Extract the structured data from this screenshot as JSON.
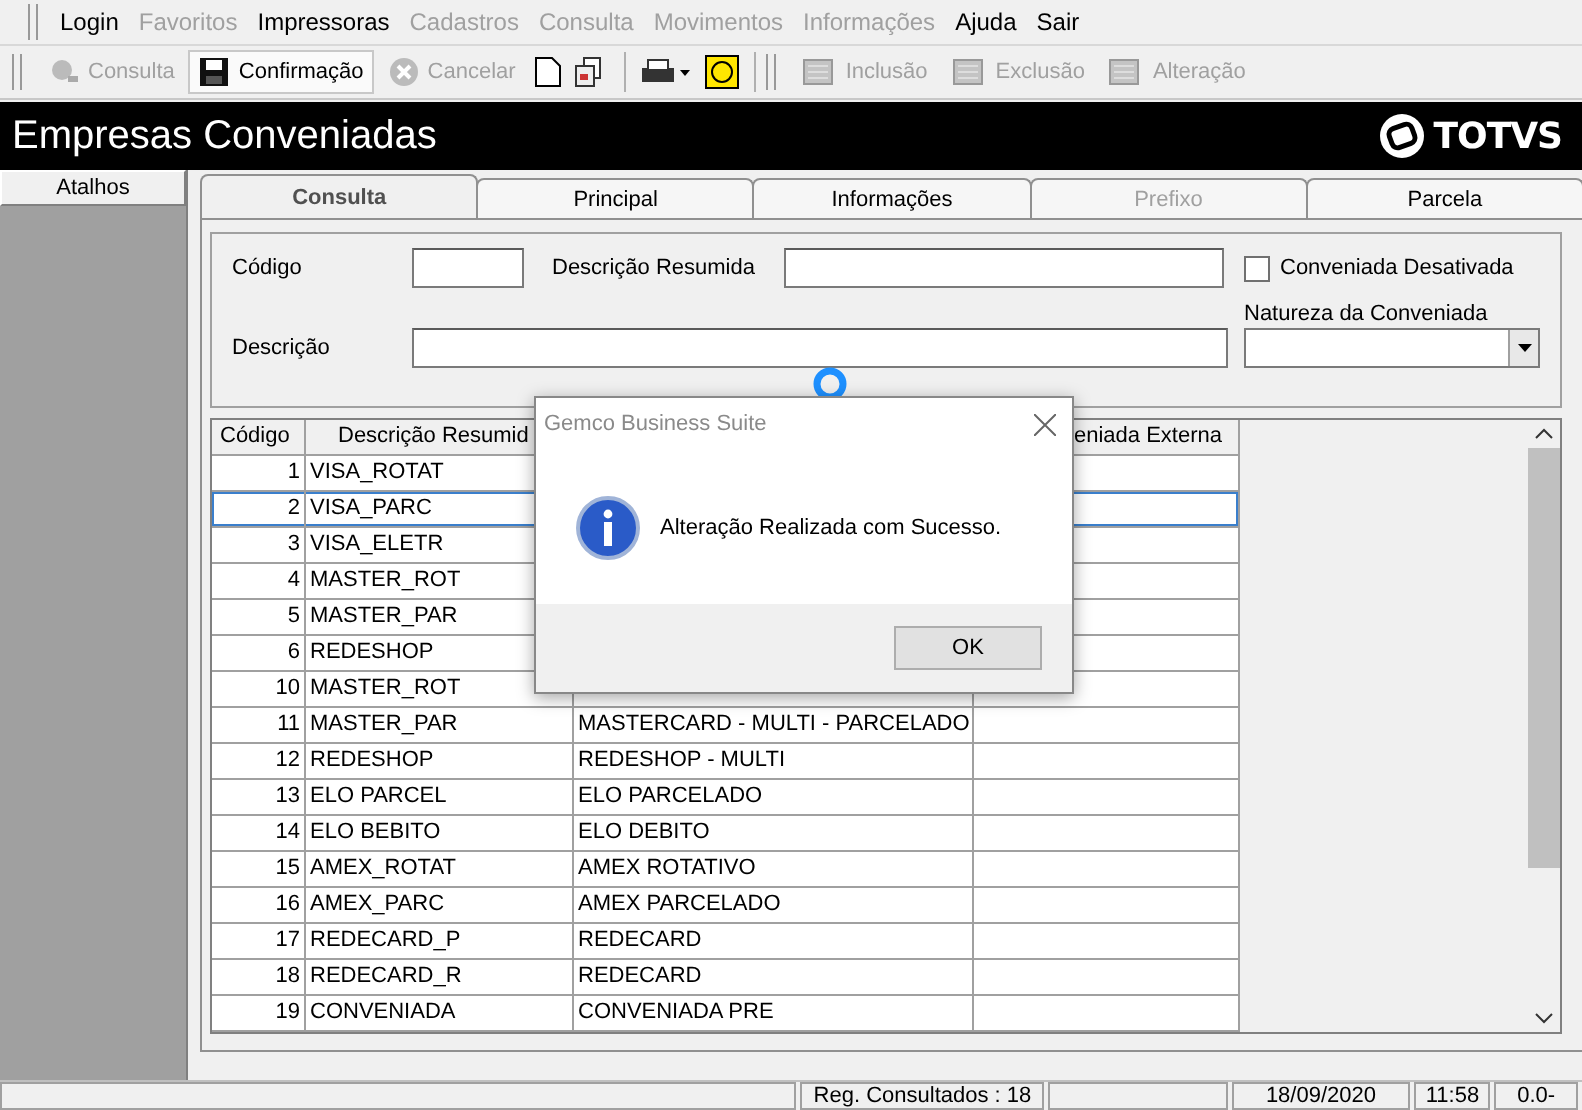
{
  "menu": [
    {
      "label": "Login",
      "disabled": false
    },
    {
      "label": "Favoritos",
      "disabled": true
    },
    {
      "label": "Impressoras",
      "disabled": false
    },
    {
      "label": "Cadastros",
      "disabled": true
    },
    {
      "label": "Consulta",
      "disabled": true
    },
    {
      "label": "Movimentos",
      "disabled": true
    },
    {
      "label": "Informações",
      "disabled": true
    },
    {
      "label": "Ajuda",
      "disabled": false
    },
    {
      "label": "Sair",
      "disabled": false
    }
  ],
  "toolbar": {
    "actions": [
      {
        "label": "Consulta",
        "disabled": true,
        "pressed": false
      },
      {
        "label": "Confirmação",
        "disabled": false,
        "pressed": true
      },
      {
        "label": "Cancelar",
        "disabled": true,
        "pressed": false
      }
    ],
    "records": [
      {
        "label": "Inclusão",
        "disabled": true
      },
      {
        "label": "Exclusão",
        "disabled": true
      },
      {
        "label": "Alteração",
        "disabled": true
      }
    ]
  },
  "header": {
    "title": "Empresas Conveniadas",
    "brand": "TOTVS"
  },
  "sidebar": {
    "title": "Atalhos"
  },
  "tabs": [
    {
      "label": "Consulta",
      "selected": true,
      "disabled": false
    },
    {
      "label": "Principal",
      "selected": false,
      "disabled": false
    },
    {
      "label": "Informações",
      "selected": false,
      "disabled": false
    },
    {
      "label": "Prefixo",
      "selected": false,
      "disabled": true
    },
    {
      "label": "Parcela",
      "selected": false,
      "disabled": false
    }
  ],
  "form": {
    "codigo_label": "Código",
    "resumida_label": "Descrição Resumida",
    "descricao_label": "Descrição",
    "desativada": {
      "label": "Conveniada Desativada",
      "checked": false
    },
    "natureza_label": "Natureza da Conveniada"
  },
  "table": {
    "columns": [
      "Código",
      "Descrição Resumid",
      "",
      "eniada Externa"
    ],
    "rows": [
      {
        "code": "1",
        "short": "VISA_ROTAT",
        "desc": "",
        "selected": false
      },
      {
        "code": "2",
        "short": "VISA_PARC",
        "desc": "",
        "selected": true
      },
      {
        "code": "3",
        "short": "VISA_ELETR",
        "desc": "",
        "selected": false
      },
      {
        "code": "4",
        "short": "MASTER_ROT",
        "desc": "",
        "selected": false
      },
      {
        "code": "5",
        "short": "MASTER_PAR",
        "desc": "",
        "selected": false
      },
      {
        "code": "6",
        "short": "REDESHOP",
        "desc": "",
        "selected": false
      },
      {
        "code": "10",
        "short": "MASTER_ROT",
        "desc": "",
        "selected": false
      },
      {
        "code": "11",
        "short": "MASTER_PAR",
        "desc": "MASTERCARD - MULTI - PARCELADO",
        "selected": false
      },
      {
        "code": "12",
        "short": "REDESHOP",
        "desc": "REDESHOP - MULTI",
        "selected": false
      },
      {
        "code": "13",
        "short": "ELO PARCEL",
        "desc": "ELO PARCELADO",
        "selected": false
      },
      {
        "code": "14",
        "short": "ELO BEBITO",
        "desc": "ELO DEBITO",
        "selected": false
      },
      {
        "code": "15",
        "short": "AMEX_ROTAT",
        "desc": "AMEX ROTATIVO",
        "selected": false
      },
      {
        "code": "16",
        "short": "AMEX_PARC",
        "desc": "AMEX PARCELADO",
        "selected": false
      },
      {
        "code": "17",
        "short": "REDECARD_P",
        "desc": "REDECARD",
        "selected": false
      },
      {
        "code": "18",
        "short": "REDECARD_R",
        "desc": "REDECARD",
        "selected": false
      },
      {
        "code": "19",
        "short": "CONVENIADA",
        "desc": "CONVENIADA PRE",
        "selected": false
      }
    ]
  },
  "dialog": {
    "title": "Gemco Business Suite",
    "message": "Alteração Realizada com Sucesso.",
    "button": "OK"
  },
  "status_bar": {
    "records": "Reg. Consultados : 18",
    "date": "18/09/2020",
    "time": "11:58",
    "version": "0.0-"
  }
}
